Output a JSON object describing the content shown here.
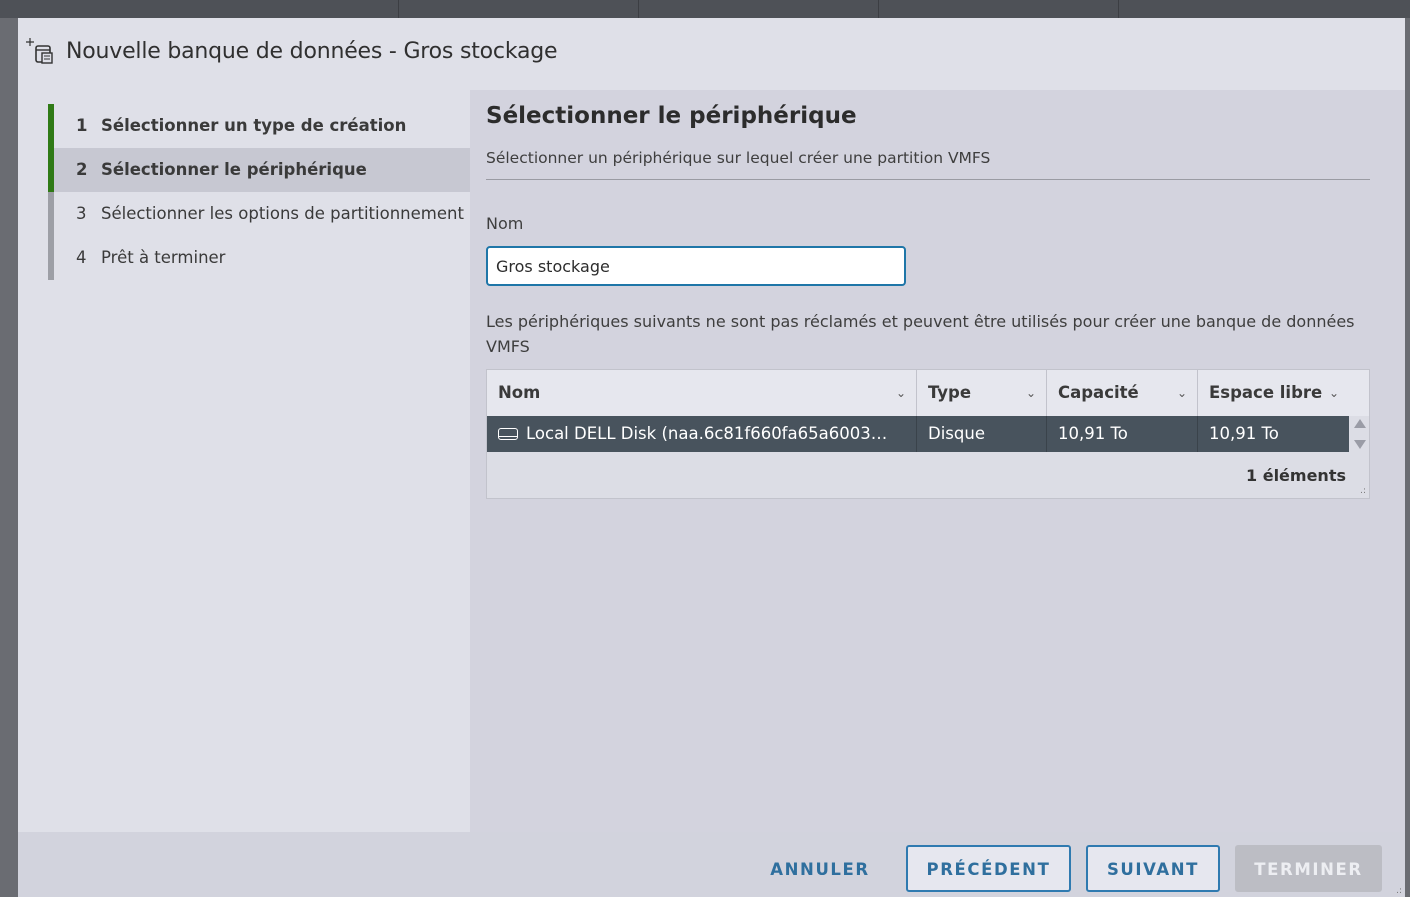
{
  "dialog": {
    "title": "Nouvelle banque de données - Gros stockage"
  },
  "steps": [
    {
      "num": "1",
      "label": "Sélectionner un type de création"
    },
    {
      "num": "2",
      "label": "Sélectionner le périphérique"
    },
    {
      "num": "3",
      "label": "Sélectionner les options de partitionnement"
    },
    {
      "num": "4",
      "label": "Prêt à terminer"
    }
  ],
  "page": {
    "title": "Sélectionner le périphérique",
    "subtitle": "Sélectionner un périphérique sur lequel créer une partition VMFS",
    "name_label": "Nom",
    "name_value": "Gros stockage",
    "description": "Les périphériques suivants ne sont pas réclamés et peuvent être utilisés pour créer une banque de données VMFS"
  },
  "table": {
    "columns": [
      "Nom",
      "Type",
      "Capacité",
      "Espace libre"
    ],
    "rows": [
      {
        "nom": "Local DELL Disk (naa.6c81f660fa65a6003…",
        "type": "Disque",
        "capacite": "10,91 To",
        "espace_libre": "10,91 To",
        "icon": "disk-icon"
      }
    ],
    "count": "1 éléments"
  },
  "buttons": {
    "cancel": "ANNULER",
    "previous": "PRÉCÉDENT",
    "next": "SUIVANT",
    "finish": "TERMINER"
  },
  "colors": {
    "accent_blue": "#2f7ab0",
    "step_complete": "#2f7a16",
    "selected_row": "#48535d"
  }
}
